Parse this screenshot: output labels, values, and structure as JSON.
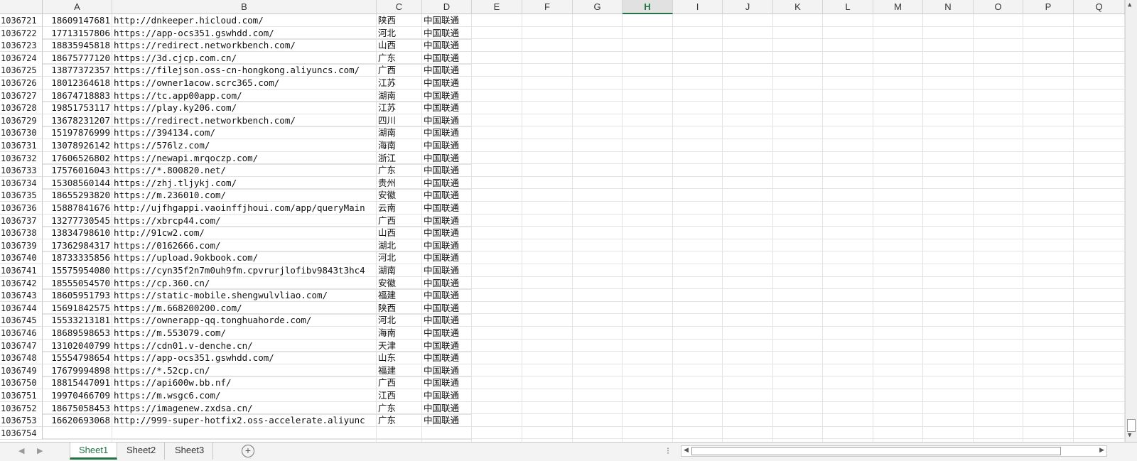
{
  "columns": [
    "A",
    "B",
    "C",
    "D",
    "E",
    "F",
    "G",
    "H",
    "I",
    "J",
    "K",
    "L",
    "M",
    "N",
    "O",
    "P",
    "Q"
  ],
  "selected_column": "H",
  "rows": [
    {
      "n": "1036721",
      "a": "18609147681",
      "b": "http://dnkeeper.hicloud.com/",
      "c": "陕西",
      "d": "中国联通"
    },
    {
      "n": "1036722",
      "a": "17713157806",
      "b": "https://app-ocs351.gswhdd.com/",
      "c": "河北",
      "d": "中国联通"
    },
    {
      "n": "1036723",
      "a": "18835945818",
      "b": "https://redirect.networkbench.com/",
      "c": "山西",
      "d": "中国联通"
    },
    {
      "n": "1036724",
      "a": "18675777120",
      "b": "https://3d.cjcp.com.cn/",
      "c": "广东",
      "d": "中国联通"
    },
    {
      "n": "1036725",
      "a": "13877372357",
      "b": "https://filejson.oss-cn-hongkong.aliyuncs.com/",
      "c": "广西",
      "d": "中国联通"
    },
    {
      "n": "1036726",
      "a": "18012364618",
      "b": "https://owner1acow.scrc365.com/",
      "c": "江苏",
      "d": "中国联通"
    },
    {
      "n": "1036727",
      "a": "18674718883",
      "b": "https://tc.app00app.com/",
      "c": "湖南",
      "d": "中国联通"
    },
    {
      "n": "1036728",
      "a": "19851753117",
      "b": "https://play.ky206.com/",
      "c": "江苏",
      "d": "中国联通"
    },
    {
      "n": "1036729",
      "a": "13678231207",
      "b": "https://redirect.networkbench.com/",
      "c": "四川",
      "d": "中国联通"
    },
    {
      "n": "1036730",
      "a": "15197876999",
      "b": "https://394134.com/",
      "c": "湖南",
      "d": "中国联通"
    },
    {
      "n": "1036731",
      "a": "13078926142",
      "b": "https://576lz.com/",
      "c": "海南",
      "d": "中国联通"
    },
    {
      "n": "1036732",
      "a": "17606526802",
      "b": "https://newapi.mrqoczp.com/",
      "c": "浙江",
      "d": "中国联通"
    },
    {
      "n": "1036733",
      "a": "17576016043",
      "b": "https://*.800820.net/",
      "c": "广东",
      "d": "中国联通"
    },
    {
      "n": "1036734",
      "a": "15308560144",
      "b": "https://zhj.tljykj.com/",
      "c": "贵州",
      "d": "中国联通"
    },
    {
      "n": "1036735",
      "a": "18655293820",
      "b": "https://m.236010.com/",
      "c": "安徽",
      "d": "中国联通"
    },
    {
      "n": "1036736",
      "a": "15887841676",
      "b": "http://ujfhgappi.vaoinffjhoui.com/app/queryMain",
      "c": "云南",
      "d": "中国联通"
    },
    {
      "n": "1036737",
      "a": "13277730545",
      "b": "https://xbrcp44.com/",
      "c": "广西",
      "d": "中国联通"
    },
    {
      "n": "1036738",
      "a": "13834798610",
      "b": "http://91cw2.com/",
      "c": "山西",
      "d": "中国联通"
    },
    {
      "n": "1036739",
      "a": "17362984317",
      "b": "https://0162666.com/",
      "c": "湖北",
      "d": "中国联通"
    },
    {
      "n": "1036740",
      "a": "18733335856",
      "b": "https://upload.9okbook.com/",
      "c": "河北",
      "d": "中国联通"
    },
    {
      "n": "1036741",
      "a": "15575954080",
      "b": "https://cyn35f2n7m0uh9fm.cpvrurjlofibv9843t3hc4",
      "c": "湖南",
      "d": "中国联通"
    },
    {
      "n": "1036742",
      "a": "18555054570",
      "b": "https://cp.360.cn/",
      "c": "安徽",
      "d": "中国联通"
    },
    {
      "n": "1036743",
      "a": "18605951793",
      "b": "https://static-mobile.shengwulvliao.com/",
      "c": "福建",
      "d": "中国联通"
    },
    {
      "n": "1036744",
      "a": "15691842575",
      "b": "https://m.668200200.com/",
      "c": "陕西",
      "d": "中国联通"
    },
    {
      "n": "1036745",
      "a": "15533213181",
      "b": "https://ownerapp-qq.tonghuahorde.com/",
      "c": "河北",
      "d": "中国联通"
    },
    {
      "n": "1036746",
      "a": "18689598653",
      "b": "https://m.553079.com/",
      "c": "海南",
      "d": "中国联通"
    },
    {
      "n": "1036747",
      "a": "13102040799",
      "b": "https://cdn01.v-denche.cn/",
      "c": "天津",
      "d": "中国联通"
    },
    {
      "n": "1036748",
      "a": "15554798654",
      "b": "https://app-ocs351.gswhdd.com/",
      "c": "山东",
      "d": "中国联通"
    },
    {
      "n": "1036749",
      "a": "17679994898",
      "b": "https://*.52cp.cn/",
      "c": "福建",
      "d": "中国联通"
    },
    {
      "n": "1036750",
      "a": "18815447091",
      "b": "https://api600w.bb.nf/",
      "c": "广西",
      "d": "中国联通"
    },
    {
      "n": "1036751",
      "a": "19970466709",
      "b": "https://m.wsgc6.com/",
      "c": "江西",
      "d": "中国联通"
    },
    {
      "n": "1036752",
      "a": "18675058453",
      "b": "https://imagenew.zxdsa.cn/",
      "c": "广东",
      "d": "中国联通"
    },
    {
      "n": "1036753",
      "a": "16620693068",
      "b": "http://999-super-hotfix2.oss-accelerate.aliyunc",
      "c": "广东",
      "d": "中国联通"
    },
    {
      "n": "1036754",
      "a": "",
      "b": "",
      "c": "",
      "d": ""
    }
  ],
  "sheets": [
    "Sheet1",
    "Sheet2",
    "Sheet3"
  ],
  "active_sheet": "Sheet1",
  "add_sheet_label": "+",
  "colors": {
    "accent": "#217346",
    "header_bg": "#f3f3f3",
    "gridline": "#e3e3e3"
  },
  "icons": {
    "add_sheet": "plus-circle-icon",
    "prev_sheet": "caret-left-icon",
    "next_sheet": "caret-right-icon",
    "options": "ellipsis-icon"
  }
}
